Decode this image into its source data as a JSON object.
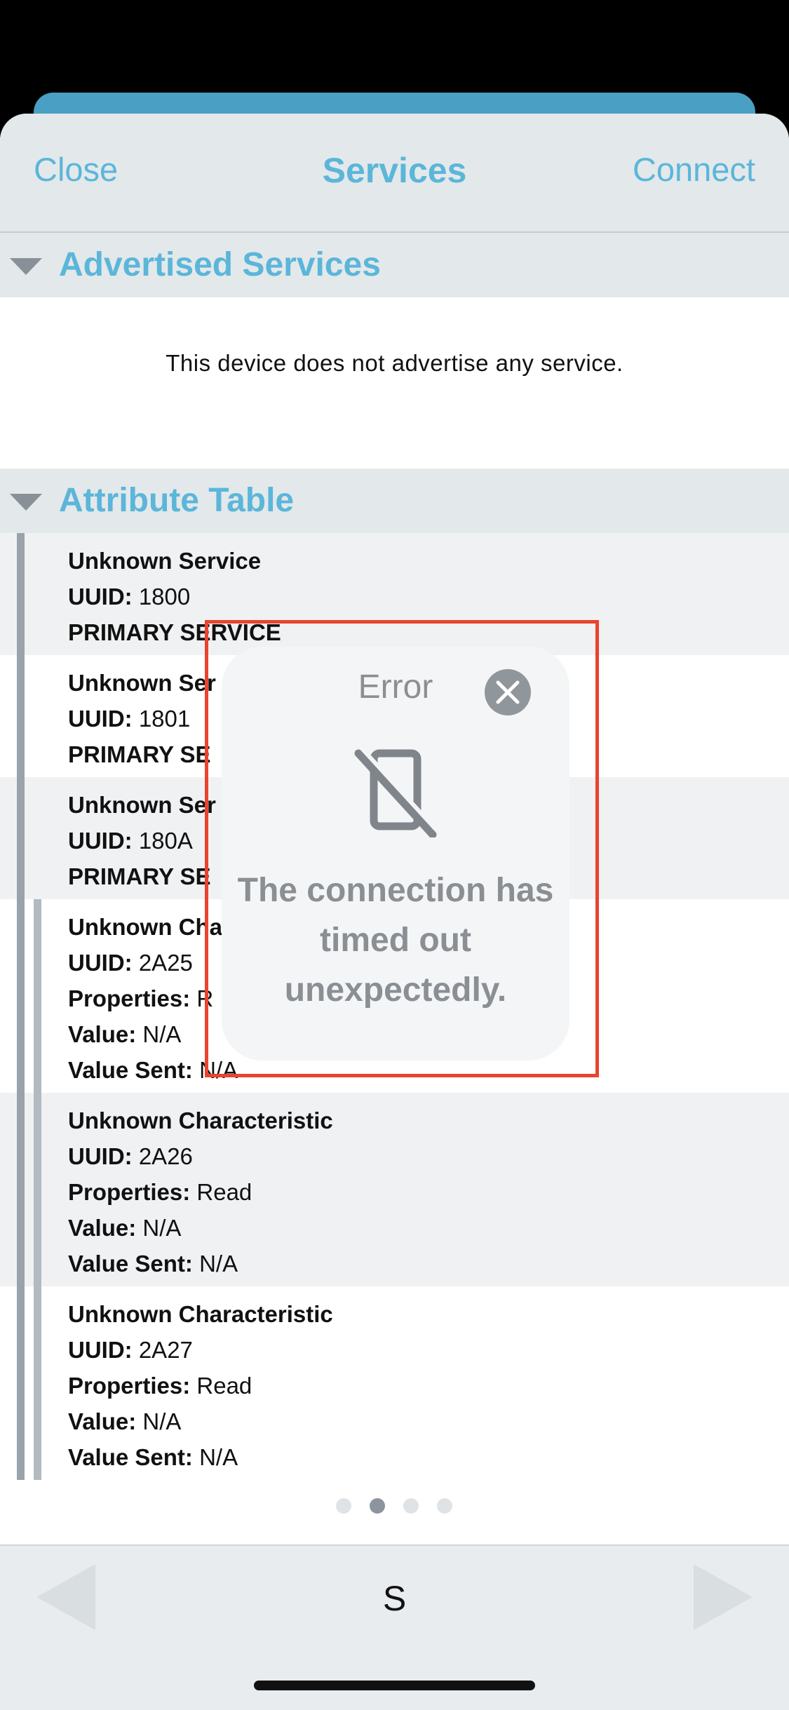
{
  "navbar": {
    "close_label": "Close",
    "title": "Services",
    "connect_label": "Connect"
  },
  "advertised": {
    "title": "Advertised Services",
    "empty_message": "This device does not advertise any service."
  },
  "attribute_table": {
    "title": "Attribute Table",
    "rows": [
      {
        "name": "Unknown Service",
        "uuid_label": "UUID:",
        "uuid": "1800",
        "type": "PRIMARY SERVICE"
      },
      {
        "name": "Unknown Ser",
        "uuid_label": "UUID:",
        "uuid": "1801",
        "type": "PRIMARY SE"
      },
      {
        "name": "Unknown Ser",
        "uuid_label": "UUID:",
        "uuid": "180A",
        "type": "PRIMARY SE"
      },
      {
        "name": "Unknown Cha",
        "uuid_label": "UUID:",
        "uuid": "2A25",
        "properties_label": "Properties:",
        "properties": "R",
        "value_label": "Value:",
        "value": "N/A",
        "value_sent_label": "Value Sent:",
        "value_sent": "N/A"
      },
      {
        "name": "Unknown Characteristic",
        "uuid_label": "UUID:",
        "uuid": "2A26",
        "properties_label": "Properties:",
        "properties": "Read",
        "value_label": "Value:",
        "value": "N/A",
        "value_sent_label": "Value Sent:",
        "value_sent": "N/A"
      },
      {
        "name": "Unknown Characteristic",
        "uuid_label": "UUID:",
        "uuid": "2A27",
        "properties_label": "Properties:",
        "properties": "Read",
        "value_label": "Value:",
        "value": "N/A",
        "value_sent_label": "Value Sent:",
        "value_sent": "N/A"
      }
    ]
  },
  "page_indicator": {
    "count": 4,
    "active_index": 1
  },
  "bottom_bar": {
    "center_label": "S"
  },
  "error_dialog": {
    "title": "Error",
    "message": "The connection has timed out unexpectedly.",
    "icon": "phone-disconnected-icon",
    "close_icon": "close-circle-icon"
  },
  "colors": {
    "accent": "#5bb6d9",
    "highlight_border": "#e8442f"
  }
}
